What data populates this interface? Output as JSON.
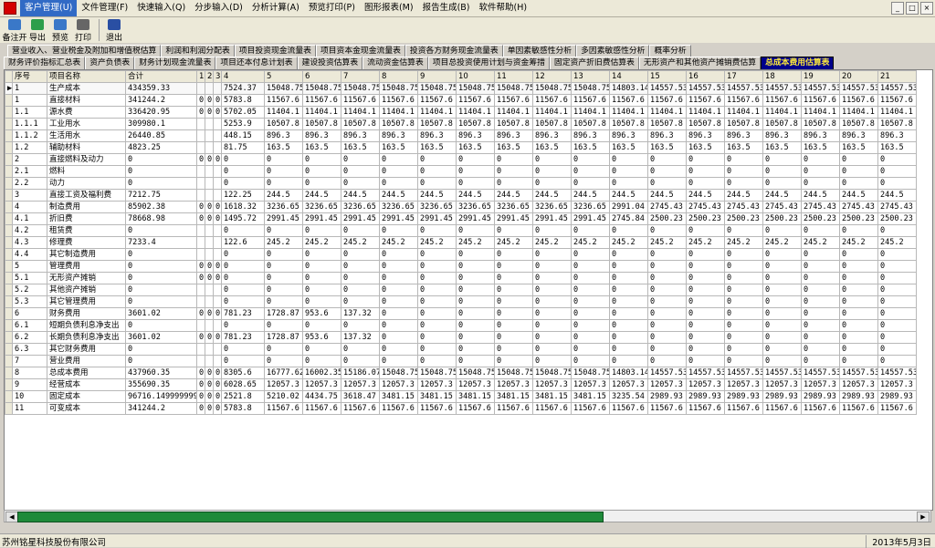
{
  "menu": [
    "客户管理(U)",
    "文件管理(F)",
    "快速输入(Q)",
    "分步输入(D)",
    "分析计算(A)",
    "预览打印(P)",
    "图形报表(M)",
    "报告生成(B)",
    "软件帮助(H)"
  ],
  "window_controls": [
    "_",
    "□",
    "×"
  ],
  "toolbar": [
    {
      "label": "备注开",
      "icon": "note-icon",
      "color": "#3a78c8"
    },
    {
      "label": "导出",
      "icon": "export-icon",
      "color": "#2d9e4a"
    },
    {
      "label": "预览",
      "icon": "preview-icon",
      "color": "#3a78c8"
    },
    {
      "label": "打印",
      "icon": "print-icon",
      "color": "#666666"
    },
    {
      "label": "退出",
      "icon": "exit-icon",
      "color": "#2a4fa3"
    }
  ],
  "tabs_row1": [
    "营业收入、营业税金及附加和增值税估算",
    "利润和利润分配表",
    "项目投资现金流量表",
    "项目资本金现金流量表",
    "投资各方财务现金流量表",
    "单因素敏感性分析",
    "多因素敏感性分析",
    "概率分析"
  ],
  "tabs_row2": [
    "财务评价指标汇总表",
    "资产负债表",
    "财务计划现金流量表",
    "项目还本付息计划表",
    "建设投资估算表",
    "流动资金估算表",
    "项目总投资使用计划与资金筹措",
    "固定资产折旧费估算表",
    "无形资产和其他资产摊销费估算",
    "总成本费用估算表"
  ],
  "selected_tab": "总成本费用估算表",
  "grid": {
    "headers": [
      "序号",
      "项目名称",
      "合计",
      "1",
      "2",
      "3",
      "4",
      "5",
      "6",
      "7",
      "8",
      "9",
      "10",
      "11",
      "12",
      "13",
      "14",
      "15",
      "16",
      "17",
      "18",
      "19",
      "20",
      "21"
    ],
    "rows": [
      [
        "1",
        "生产成本",
        "434359.33",
        "",
        "",
        "",
        "7524.37",
        "15048.75",
        "15048.75",
        "15048.75",
        "15048.75",
        "15048.75",
        "15048.75",
        "15048.75",
        "15048.75",
        "15048.75",
        "14803.14",
        "14557.53",
        "14557.53",
        "14557.53",
        "14557.53",
        "14557.53",
        "14557.53",
        "14557.53"
      ],
      [
        "1",
        "直接材料",
        "341244.2",
        "0",
        "0",
        "0",
        "5783.8",
        "11567.6",
        "11567.6",
        "11567.6",
        "11567.6",
        "11567.6",
        "11567.6",
        "11567.6",
        "11567.6",
        "11567.6",
        "11567.6",
        "11567.6",
        "11567.6",
        "11567.6",
        "11567.6",
        "11567.6",
        "11567.6",
        "11567.6"
      ],
      [
        "1.1",
        "源水费",
        "336420.95",
        "0",
        "0",
        "0",
        "5702.05",
        "11404.1",
        "11404.1",
        "11404.1",
        "11404.1",
        "11404.1",
        "11404.1",
        "11404.1",
        "11404.1",
        "11404.1",
        "11404.1",
        "11404.1",
        "11404.1",
        "11404.1",
        "11404.1",
        "11404.1",
        "11404.1",
        "11404.1"
      ],
      [
        "1.1.1",
        "工业用水",
        "309980.1",
        "",
        "",
        "",
        "5253.9",
        "10507.8",
        "10507.8",
        "10507.8",
        "10507.8",
        "10507.8",
        "10507.8",
        "10507.8",
        "10507.8",
        "10507.8",
        "10507.8",
        "10507.8",
        "10507.8",
        "10507.8",
        "10507.8",
        "10507.8",
        "10507.8",
        "10507.8"
      ],
      [
        "1.1.2",
        "生活用水",
        "26440.85",
        "",
        "",
        "",
        "448.15",
        "896.3",
        "896.3",
        "896.3",
        "896.3",
        "896.3",
        "896.3",
        "896.3",
        "896.3",
        "896.3",
        "896.3",
        "896.3",
        "896.3",
        "896.3",
        "896.3",
        "896.3",
        "896.3",
        "896.3"
      ],
      [
        "1.2",
        "辅助材料",
        "4823.25",
        "",
        "",
        "",
        "81.75",
        "163.5",
        "163.5",
        "163.5",
        "163.5",
        "163.5",
        "163.5",
        "163.5",
        "163.5",
        "163.5",
        "163.5",
        "163.5",
        "163.5",
        "163.5",
        "163.5",
        "163.5",
        "163.5",
        "163.5"
      ],
      [
        "2",
        "直接燃料及动力",
        "0",
        "0",
        "0",
        "0",
        "0",
        "0",
        "0",
        "0",
        "0",
        "0",
        "0",
        "0",
        "0",
        "0",
        "0",
        "0",
        "0",
        "0",
        "0",
        "0",
        "0",
        "0"
      ],
      [
        "2.1",
        "燃料",
        "0",
        "",
        "",
        "",
        "0",
        "0",
        "0",
        "0",
        "0",
        "0",
        "0",
        "0",
        "0",
        "0",
        "0",
        "0",
        "0",
        "0",
        "0",
        "0",
        "0",
        "0"
      ],
      [
        "2.2",
        "动力",
        "0",
        "",
        "",
        "",
        "0",
        "0",
        "0",
        "0",
        "0",
        "0",
        "0",
        "0",
        "0",
        "0",
        "0",
        "0",
        "0",
        "0",
        "0",
        "0",
        "0",
        "0"
      ],
      [
        "3",
        "直接工资及福利费",
        "7212.75",
        "",
        "",
        "",
        "122.25",
        "244.5",
        "244.5",
        "244.5",
        "244.5",
        "244.5",
        "244.5",
        "244.5",
        "244.5",
        "244.5",
        "244.5",
        "244.5",
        "244.5",
        "244.5",
        "244.5",
        "244.5",
        "244.5",
        "244.5"
      ],
      [
        "4",
        "制造费用",
        "85902.38",
        "0",
        "0",
        "0",
        "1618.32",
        "3236.65",
        "3236.65",
        "3236.65",
        "3236.65",
        "3236.65",
        "3236.65",
        "3236.65",
        "3236.65",
        "3236.65",
        "2991.04",
        "2745.43",
        "2745.43",
        "2745.43",
        "2745.43",
        "2745.43",
        "2745.43",
        "2745.43"
      ],
      [
        "4.1",
        "折旧费",
        "78668.98",
        "0",
        "0",
        "0",
        "1495.72",
        "2991.45",
        "2991.45",
        "2991.45",
        "2991.45",
        "2991.45",
        "2991.45",
        "2991.45",
        "2991.45",
        "2991.45",
        "2745.84",
        "2500.23",
        "2500.23",
        "2500.23",
        "2500.23",
        "2500.23",
        "2500.23",
        "2500.23"
      ],
      [
        "4.2",
        "租赁费",
        "0",
        "",
        "",
        "",
        "0",
        "0",
        "0",
        "0",
        "0",
        "0",
        "0",
        "0",
        "0",
        "0",
        "0",
        "0",
        "0",
        "0",
        "0",
        "0",
        "0",
        "0"
      ],
      [
        "4.3",
        "修理费",
        "7233.4",
        "",
        "",
        "",
        "122.6",
        "245.2",
        "245.2",
        "245.2",
        "245.2",
        "245.2",
        "245.2",
        "245.2",
        "245.2",
        "245.2",
        "245.2",
        "245.2",
        "245.2",
        "245.2",
        "245.2",
        "245.2",
        "245.2",
        "245.2"
      ],
      [
        "4.4",
        "其它制造费用",
        "0",
        "",
        "",
        "",
        "0",
        "0",
        "0",
        "0",
        "0",
        "0",
        "0",
        "0",
        "0",
        "0",
        "0",
        "0",
        "0",
        "0",
        "0",
        "0",
        "0",
        "0"
      ],
      [
        "5",
        "管理费用",
        "0",
        "0",
        "0",
        "0",
        "0",
        "0",
        "0",
        "0",
        "0",
        "0",
        "0",
        "0",
        "0",
        "0",
        "0",
        "0",
        "0",
        "0",
        "0",
        "0",
        "0",
        "0"
      ],
      [
        "5.1",
        "无形资产摊销",
        "0",
        "0",
        "0",
        "0",
        "0",
        "0",
        "0",
        "0",
        "0",
        "0",
        "0",
        "0",
        "0",
        "0",
        "0",
        "0",
        "0",
        "0",
        "0",
        "0",
        "0",
        "0"
      ],
      [
        "5.2",
        "其他资产摊销",
        "0",
        "",
        "",
        "",
        "0",
        "0",
        "0",
        "0",
        "0",
        "0",
        "0",
        "0",
        "0",
        "0",
        "0",
        "0",
        "0",
        "0",
        "0",
        "0",
        "0",
        "0"
      ],
      [
        "5.3",
        "其它管理费用",
        "0",
        "",
        "",
        "",
        "0",
        "0",
        "0",
        "0",
        "0",
        "0",
        "0",
        "0",
        "0",
        "0",
        "0",
        "0",
        "0",
        "0",
        "0",
        "0",
        "0",
        "0"
      ],
      [
        "6",
        "财务费用",
        "3601.02",
        "0",
        "0",
        "0",
        "781.23",
        "1728.87",
        "953.6",
        "137.32",
        "0",
        "0",
        "0",
        "0",
        "0",
        "0",
        "0",
        "0",
        "0",
        "0",
        "0",
        "0",
        "0",
        "0"
      ],
      [
        "6.1",
        "短期负债利息净支出",
        "0",
        "",
        "",
        "",
        "0",
        "0",
        "0",
        "0",
        "0",
        "0",
        "0",
        "0",
        "0",
        "0",
        "0",
        "0",
        "0",
        "0",
        "0",
        "0",
        "0",
        "0"
      ],
      [
        "6.2",
        "长期负债利息净支出",
        "3601.02",
        "0",
        "0",
        "0",
        "781.23",
        "1728.87",
        "953.6",
        "137.32",
        "0",
        "0",
        "0",
        "0",
        "0",
        "0",
        "0",
        "0",
        "0",
        "0",
        "0",
        "0",
        "0",
        "0"
      ],
      [
        "6.3",
        "其它财务费用",
        "0",
        "",
        "",
        "",
        "0",
        "0",
        "0",
        "0",
        "0",
        "0",
        "0",
        "0",
        "0",
        "0",
        "0",
        "0",
        "0",
        "0",
        "0",
        "0",
        "0",
        "0"
      ],
      [
        "7",
        "营业费用",
        "0",
        "",
        "",
        "",
        "0",
        "0",
        "0",
        "0",
        "0",
        "0",
        "0",
        "0",
        "0",
        "0",
        "0",
        "0",
        "0",
        "0",
        "0",
        "0",
        "0",
        "0"
      ],
      [
        "8",
        "总成本费用",
        "437960.35",
        "0",
        "0",
        "0",
        "8305.6",
        "16777.62",
        "16002.35",
        "15186.07",
        "15048.75",
        "15048.75",
        "15048.75",
        "15048.75",
        "15048.75",
        "15048.75",
        "14803.14",
        "14557.53",
        "14557.53",
        "14557.53",
        "14557.53",
        "14557.53",
        "14557.53",
        "14557.53"
      ],
      [
        "9",
        "经营成本",
        "355690.35",
        "0",
        "0",
        "0",
        "6028.65",
        "12057.3",
        "12057.3",
        "12057.3",
        "12057.3",
        "12057.3",
        "12057.3",
        "12057.3",
        "12057.3",
        "12057.3",
        "12057.3",
        "12057.3",
        "12057.3",
        "12057.3",
        "12057.3",
        "12057.3",
        "12057.3",
        "12057.3"
      ],
      [
        "10",
        "固定成本",
        "96716.1499999999",
        "0",
        "0",
        "0",
        "2521.8",
        "5210.02",
        "4434.75",
        "3618.47",
        "3481.15",
        "3481.15",
        "3481.15",
        "3481.15",
        "3481.15",
        "3481.15",
        "3235.54",
        "2989.93",
        "2989.93",
        "2989.93",
        "2989.93",
        "2989.93",
        "2989.93",
        "2989.93"
      ],
      [
        "11",
        "可变成本",
        "341244.2",
        "0",
        "0",
        "0",
        "5783.8",
        "11567.6",
        "11567.6",
        "11567.6",
        "11567.6",
        "11567.6",
        "11567.6",
        "11567.6",
        "11567.6",
        "11567.6",
        "11567.6",
        "11567.6",
        "11567.6",
        "11567.6",
        "11567.6",
        "11567.6",
        "11567.6",
        "11567.6"
      ]
    ]
  },
  "scroll_arrows": {
    "left": "◀",
    "right": "▶"
  },
  "row_indicator": "▶",
  "status": {
    "company": "苏州铭星科技股份有限公司",
    "date": "2013年5月3日"
  },
  "colors": {
    "selected_tab_bg": "#00008b",
    "selected_tab_fg": "#ffeb3b",
    "scroll_thumb": "#1f8a3a",
    "app_icon": "#d40000"
  }
}
